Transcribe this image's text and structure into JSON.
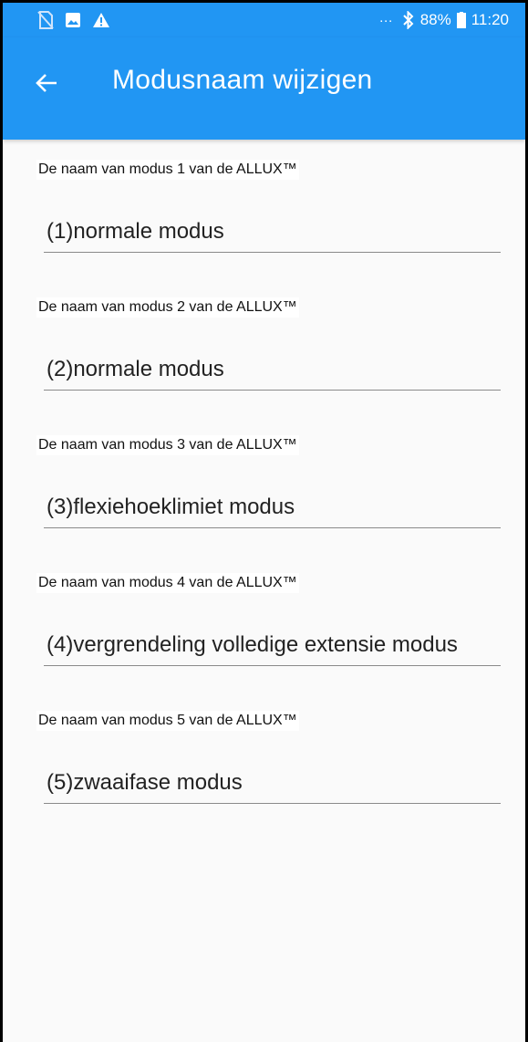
{
  "status_bar": {
    "icons_left": [
      "sim-off-icon",
      "image-icon",
      "warning-icon"
    ],
    "dots": "···",
    "battery_percent": "88%",
    "time": "11:20",
    "accent_color": "#2196f3"
  },
  "app_bar": {
    "title": "Modusnaam wijzigen",
    "back_icon": "arrow-back-icon"
  },
  "fields": [
    {
      "label": "De naam van modus 1 van de ALLUX™",
      "value": "(1)normale modus"
    },
    {
      "label": "De naam van modus 2 van de ALLUX™",
      "value": "(2)normale modus"
    },
    {
      "label": "De naam van modus 3 van de ALLUX™",
      "value": "(3)flexiehoeklimiet modus"
    },
    {
      "label": "De naam van modus 4 van de ALLUX™",
      "value": "(4)vergrendeling volledige extensie modus"
    },
    {
      "label": "De naam van modus 5 van de ALLUX™",
      "value": "(5)zwaaifase modus"
    }
  ]
}
